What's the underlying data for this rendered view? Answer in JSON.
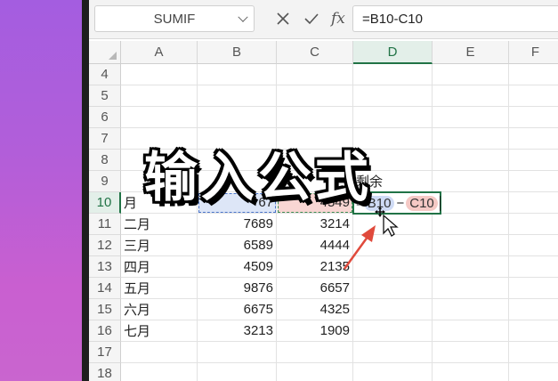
{
  "formula_bar": {
    "name_box": "SUMIF",
    "formula": "=B10-C10",
    "cancel_icon": "close-icon",
    "confirm_icon": "check-icon",
    "fx_label": "fx"
  },
  "columns": [
    "A",
    "B",
    "C",
    "D",
    "E",
    "F"
  ],
  "rows": [
    {
      "num": "4",
      "a": "",
      "b": "",
      "c": "",
      "d": ""
    },
    {
      "num": "5",
      "a": "",
      "b": "",
      "c": "",
      "d": ""
    },
    {
      "num": "6",
      "a": "",
      "b": "",
      "c": "",
      "d": ""
    },
    {
      "num": "7",
      "a": "",
      "b": "",
      "c": "",
      "d": ""
    },
    {
      "num": "8",
      "a": "",
      "b": "",
      "c": "",
      "d": ""
    },
    {
      "num": "9",
      "a": "",
      "b": "",
      "c": "",
      "d": "剩余"
    },
    {
      "num": "10",
      "a": "月",
      "b": "67",
      "c": "4549",
      "d": ""
    },
    {
      "num": "11",
      "a": "二月",
      "b": "7689",
      "c": "3214",
      "d": ""
    },
    {
      "num": "12",
      "a": "三月",
      "b": "6589",
      "c": "4444",
      "d": ""
    },
    {
      "num": "13",
      "a": "四月",
      "b": "4509",
      "c": "2135",
      "d": ""
    },
    {
      "num": "14",
      "a": "五月",
      "b": "9876",
      "c": "6657",
      "d": ""
    },
    {
      "num": "15",
      "a": "六月",
      "b": "6675",
      "c": "4325",
      "d": ""
    },
    {
      "num": "16",
      "a": "七月",
      "b": "3213",
      "c": "1909",
      "d": ""
    },
    {
      "num": "17",
      "a": "",
      "b": "",
      "c": "",
      "d": ""
    },
    {
      "num": "18",
      "a": "",
      "b": "",
      "c": "",
      "d": ""
    }
  ],
  "edit_cell": {
    "eq": "=",
    "ref1": "B10",
    "op": "−",
    "ref2": "C10"
  },
  "caption": "输入公式",
  "colors": {
    "accent": "#217346",
    "ref_b": "#4a74c9",
    "ref_c": "#e8a8a2",
    "arrow": "#e04a3c"
  }
}
